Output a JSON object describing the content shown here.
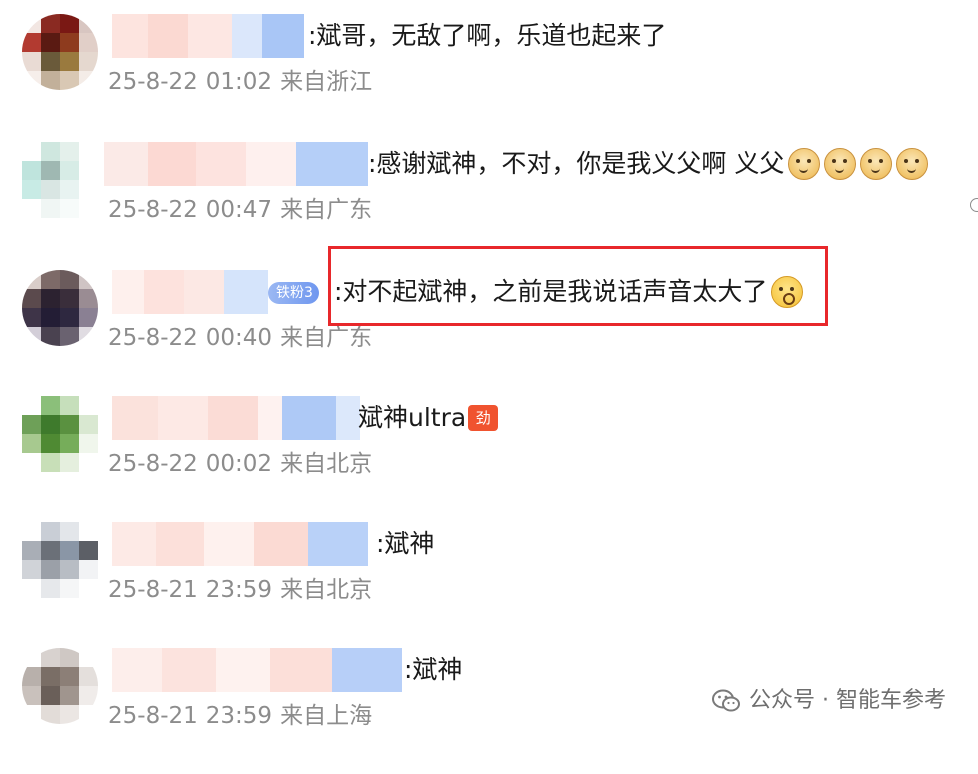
{
  "comments": [
    {
      "text": ":斌哥，无敌了啊，乐道也起来了",
      "date": "25-8-22",
      "time": "01:02",
      "location": "来自浙江"
    },
    {
      "text": ":感谢斌神，不对，你是我义父啊 义父",
      "emoji_names": [
        "doge-icon",
        "doge-icon",
        "doge-icon",
        "doge-icon"
      ],
      "date": "25-8-22",
      "time": "00:47",
      "location": "来自广东"
    },
    {
      "fan_badge": "铁粉3",
      "text": ":对不起斌神，之前是我说话声音太大了",
      "emoji_names": [
        "crying-face-icon"
      ],
      "date": "25-8-22",
      "time": "00:40",
      "location": "来自广东",
      "highlighted": true
    },
    {
      "text": "斌神ultra",
      "tag_icon": "劲",
      "date": "25-8-22",
      "time": "00:02",
      "location": "来自北京"
    },
    {
      "text": ":斌神",
      "date": "25-8-21",
      "time": "23:59",
      "location": "来自北京"
    },
    {
      "text": ":斌神",
      "date": "25-8-21",
      "time": "23:59",
      "location": "来自上海"
    }
  ],
  "watermark": {
    "text": "公众号 · 智能车参考",
    "icon": "wechat-icon"
  },
  "colors": {
    "highlight_border": "#e8282b",
    "meta_text": "#8c8c8c",
    "fan_badge": "#6f97ef",
    "tag_icon": "#f0532f"
  }
}
